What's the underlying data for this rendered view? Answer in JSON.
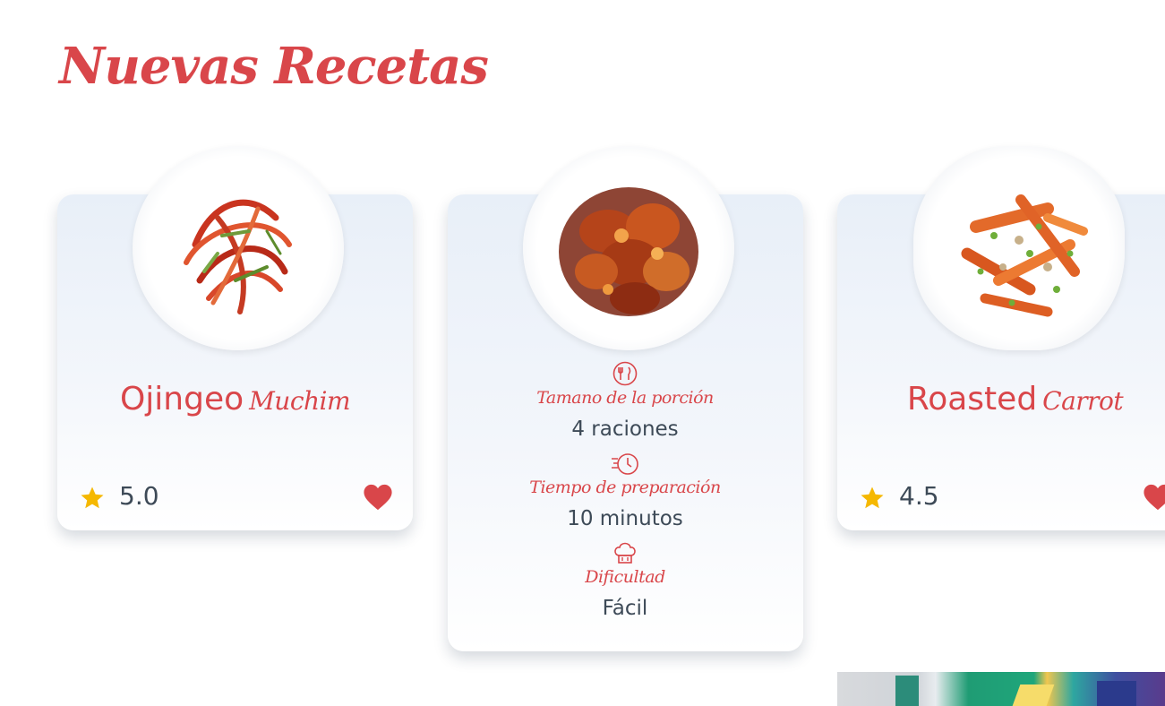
{
  "section": {
    "title": "Nuevas Recetas"
  },
  "cards": [
    {
      "title_main": "Ojingeo",
      "title_script": "Muchim",
      "rating": "5.0"
    },
    {
      "info": [
        {
          "icon": "utensils-icon",
          "label": "Tamano de la porción",
          "value": "4 raciones"
        },
        {
          "icon": "stopwatch-icon",
          "label": "Tiempo de preparación",
          "value": "10 minutos"
        },
        {
          "icon": "chef-hat-icon",
          "label": "Dificultad",
          "value": "Fácil"
        }
      ]
    },
    {
      "title_main": "Roasted",
      "title_script": "Carrot",
      "rating": "4.5"
    }
  ],
  "colors": {
    "accent": "#d9464a",
    "text": "#3d4a57",
    "star": "#f5b800",
    "card_bg_top": "#e8eff8"
  }
}
